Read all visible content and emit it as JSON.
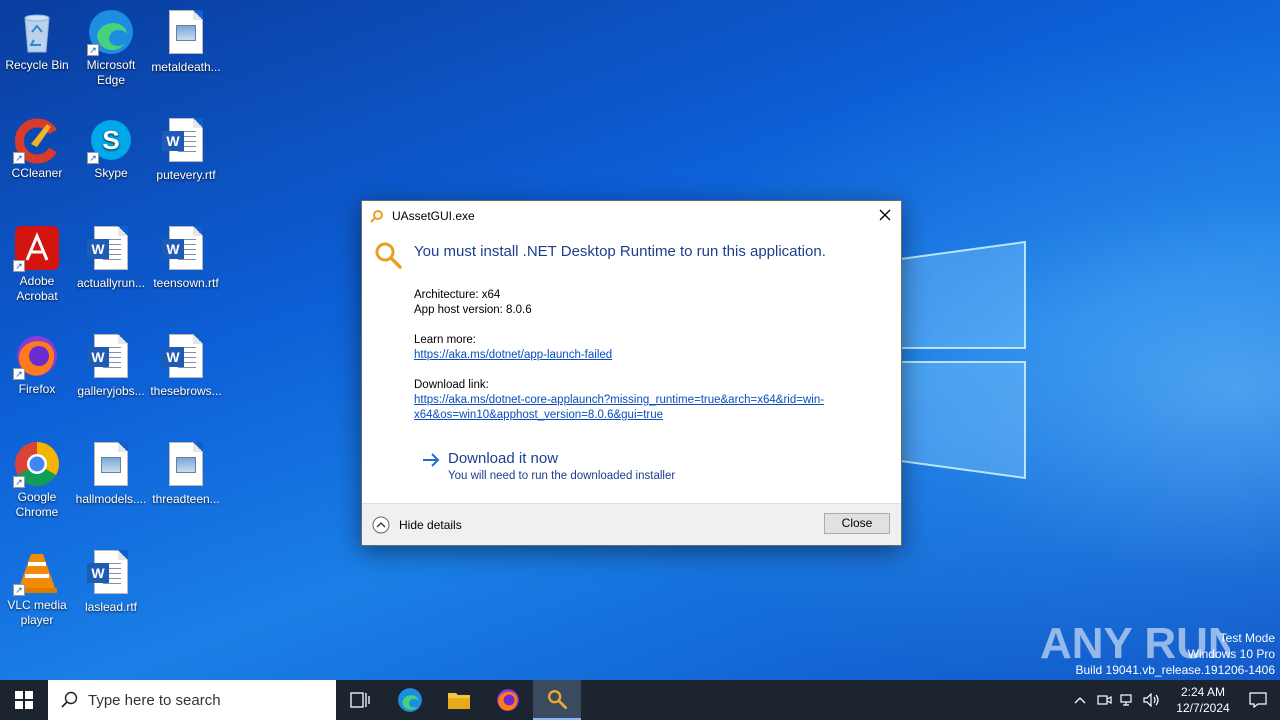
{
  "desktop": {
    "icons": [
      {
        "label": "Recycle Bin",
        "icon": "recycle-bin-icon"
      },
      {
        "label": "Microsoft Edge",
        "icon": "edge-icon"
      },
      {
        "label": "metaldeath...",
        "icon": "image-file-icon"
      },
      {
        "label": "CCleaner",
        "icon": "ccleaner-icon"
      },
      {
        "label": "Skype",
        "icon": "skype-icon"
      },
      {
        "label": "putevery.rtf",
        "icon": "word-doc-icon"
      },
      {
        "label": "Adobe Acrobat",
        "icon": "acrobat-icon"
      },
      {
        "label": "actuallyrun...",
        "icon": "word-doc-icon"
      },
      {
        "label": "teensown.rtf",
        "icon": "word-doc-icon"
      },
      {
        "label": "Firefox",
        "icon": "firefox-icon"
      },
      {
        "label": "galleryjobs...",
        "icon": "word-doc-icon"
      },
      {
        "label": "thesebrows...",
        "icon": "word-doc-icon"
      },
      {
        "label": "Google Chrome",
        "icon": "chrome-icon"
      },
      {
        "label": "hallmodels....",
        "icon": "image-file-icon"
      },
      {
        "label": "threadteen...",
        "icon": "image-file-icon"
      },
      {
        "label": "VLC media player",
        "icon": "vlc-icon"
      },
      {
        "label": "laslead.rtf",
        "icon": "word-doc-icon"
      }
    ]
  },
  "dialog": {
    "title": "UAssetGUI.exe",
    "heading": "You must install .NET Desktop Runtime to run this application.",
    "architecture": "Architecture: x64",
    "app_host_version": "App host version: 8.0.6",
    "learn_more_label": "Learn more:",
    "learn_more_link": "https://aka.ms/dotnet/app-launch-failed",
    "download_label": "Download link:",
    "download_link_line1": "https://aka.ms/dotnet-core-applaunch?missing_runtime=true&arch=x64&rid=win-",
    "download_link_line2": "x64&os=win10&apphost_version=8.0.6&gui=true",
    "download_now": "Download it now",
    "download_now_sub": "You will need to run the downloaded installer",
    "hide_details": "Hide details",
    "close_button": "Close"
  },
  "watermark": {
    "brand": "ANY RUN",
    "mode": "Test Mode",
    "edition": "Windows 10 Pro",
    "build": "Build 19041.vb_release.191206-1406"
  },
  "taskbar": {
    "search_placeholder": "Type here to search",
    "time": "2:24 AM",
    "date": "12/7/2024"
  },
  "colors": {
    "accent_link": "#0a4dbf",
    "heading": "#1c3f8f",
    "taskbar": "#1c2430"
  }
}
